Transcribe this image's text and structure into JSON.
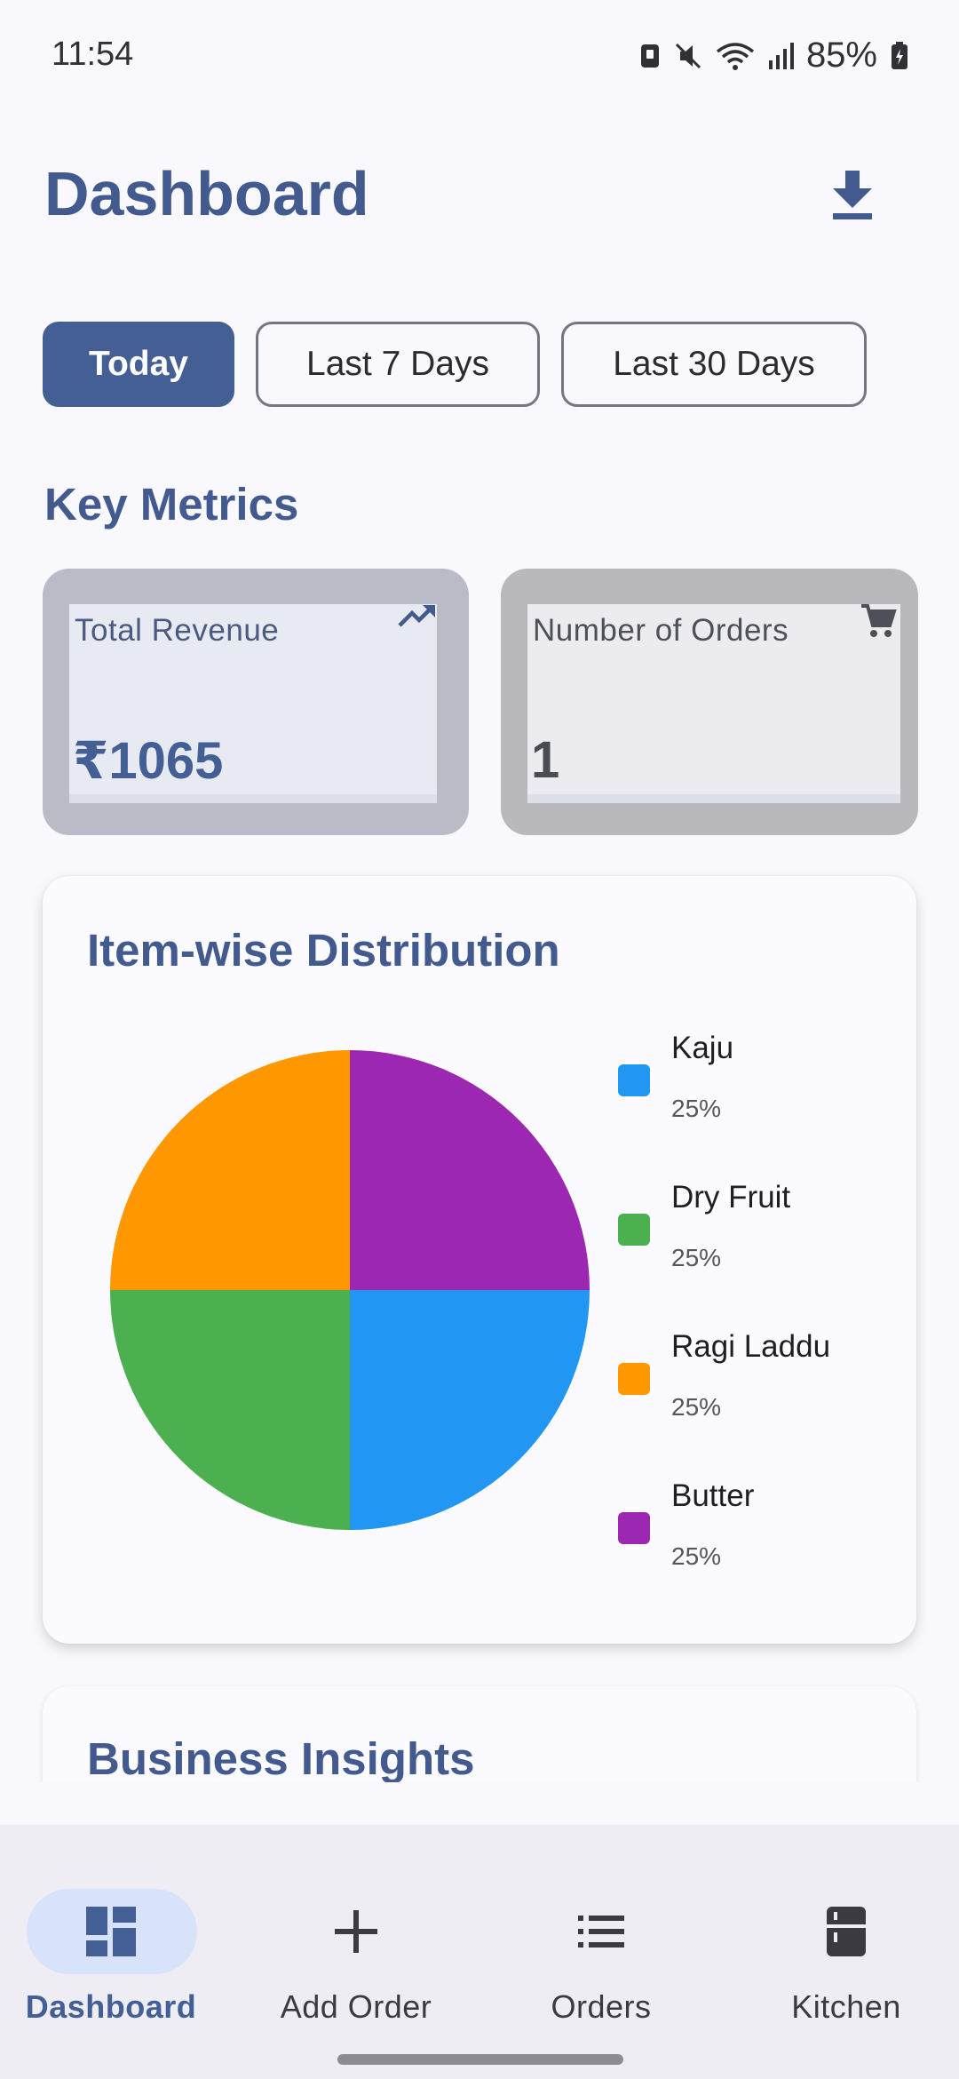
{
  "status_bar": {
    "time": "11:54",
    "battery": "85%"
  },
  "header": {
    "title": "Dashboard",
    "download_icon": "download-icon"
  },
  "filters": [
    {
      "label": "Today",
      "selected": true
    },
    {
      "label": "Last 7 Days",
      "selected": false
    },
    {
      "label": "Last 30 Days",
      "selected": false
    }
  ],
  "key_metrics": {
    "title": "Key Metrics",
    "cards": [
      {
        "label": "Total Revenue",
        "value": "₹1065",
        "icon": "trending-up-icon"
      },
      {
        "label": "Number of Orders",
        "value": "1",
        "icon": "cart-icon"
      }
    ]
  },
  "distribution": {
    "title": "Item-wise Distribution",
    "legend": [
      {
        "name": "Kaju",
        "pct": "25%",
        "color": "#2196f3"
      },
      {
        "name": "Dry Fruit",
        "pct": "25%",
        "color": "#4caf50"
      },
      {
        "name": "Ragi Laddu",
        "pct": "25%",
        "color": "#ff9800"
      },
      {
        "name": "Butter",
        "pct": "25%",
        "color": "#9c27b0"
      }
    ]
  },
  "chart_data": {
    "type": "pie",
    "title": "Item-wise Distribution",
    "categories": [
      "Kaju",
      "Dry Fruit",
      "Ragi Laddu",
      "Butter"
    ],
    "values": [
      25,
      25,
      25,
      25
    ],
    "colors": [
      "#2196f3",
      "#4caf50",
      "#ff9800",
      "#9c27b0"
    ],
    "legend": "right"
  },
  "insights": {
    "title": "Business Insights"
  },
  "bottom_nav": [
    {
      "label": "Dashboard",
      "icon": "dashboard-icon",
      "active": true
    },
    {
      "label": "Add Order",
      "icon": "plus-icon",
      "active": false
    },
    {
      "label": "Orders",
      "icon": "list-icon",
      "active": false
    },
    {
      "label": "Kitchen",
      "icon": "kitchen-icon",
      "active": false
    }
  ],
  "colors": {
    "primary": "#445f94",
    "background": "#f8f8fd",
    "nav_indicator": "#d9e2fb"
  }
}
